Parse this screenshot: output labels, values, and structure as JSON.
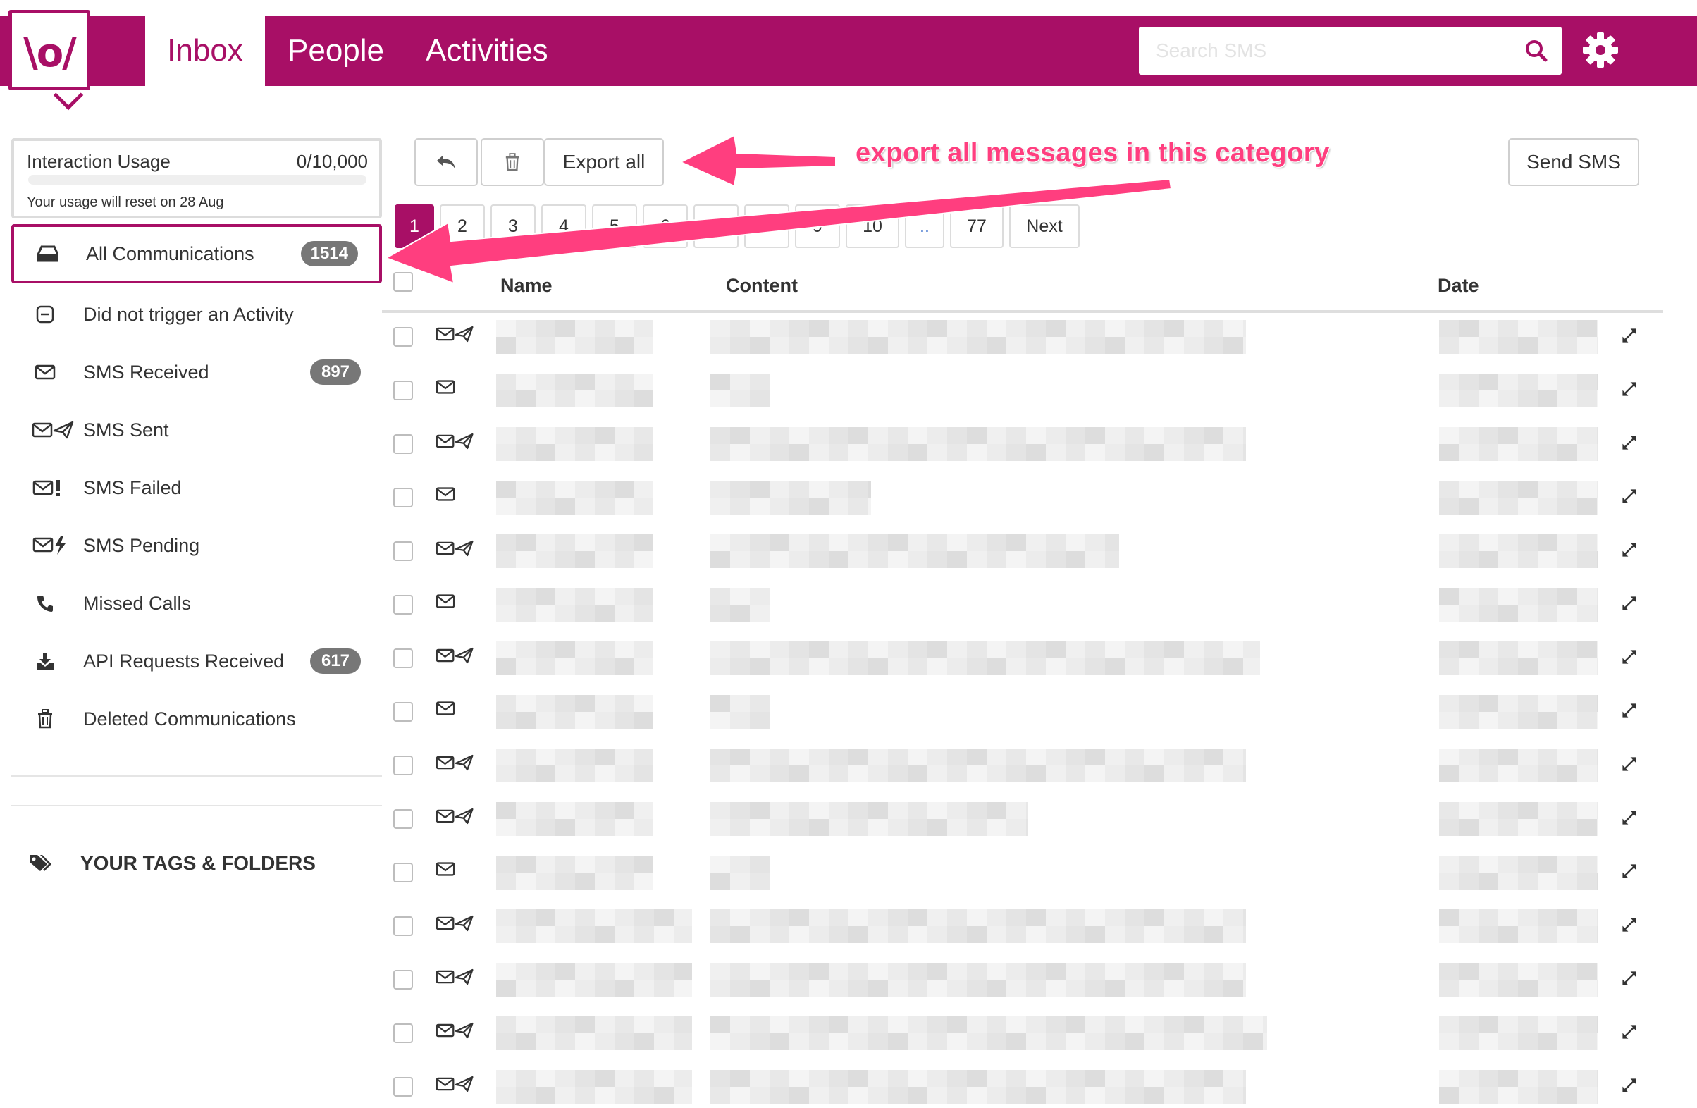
{
  "app": {
    "logo_text": "\\o/",
    "nav": {
      "inbox": "Inbox",
      "people": "People",
      "activities": "Activities"
    },
    "search": {
      "placeholder": "Search SMS",
      "value": ""
    },
    "icons": {
      "search": "search-icon",
      "settings": "gear-icon"
    },
    "colors": {
      "brand": "#a80f66",
      "badge": "#777777",
      "annotation": "#ff3e7f"
    }
  },
  "sidebar": {
    "usage": {
      "title": "Interaction Usage",
      "count": "0/10,000",
      "progress_fraction": 0,
      "note": "Your usage will reset on 28 Aug"
    },
    "items": [
      {
        "label": "All Communications",
        "badge": "1514",
        "icon": "inbox-tray-icon",
        "active": true
      },
      {
        "label": "Did not trigger an Activity",
        "badge": "",
        "icon": "minus-square-icon",
        "active": false
      },
      {
        "label": "SMS Received",
        "badge": "897",
        "icon": "envelope-icon",
        "active": false
      },
      {
        "label": "SMS Sent",
        "badge": "",
        "icon": "envelope-sent-icon",
        "active": false
      },
      {
        "label": "SMS Failed",
        "badge": "",
        "icon": "envelope-failed-icon",
        "active": false
      },
      {
        "label": "SMS Pending",
        "badge": "",
        "icon": "envelope-pending-icon",
        "active": false
      },
      {
        "label": "Missed Calls",
        "badge": "",
        "icon": "phone-icon",
        "active": false
      },
      {
        "label": "API Requests Received",
        "badge": "617",
        "icon": "download-icon",
        "active": false
      },
      {
        "label": "Deleted Communications",
        "badge": "",
        "icon": "trash-icon",
        "active": false
      }
    ],
    "tags_heading": "YOUR TAGS & FOLDERS"
  },
  "toolbar": {
    "export_label": "Export all",
    "send_label": "Send SMS",
    "reply_icon": "reply-icon",
    "delete_icon": "trash-icon"
  },
  "pagination": {
    "pages": [
      "1",
      "2",
      "3",
      "4",
      "5",
      "6",
      "7",
      "8",
      "9",
      "10",
      "..",
      "77",
      "Next"
    ],
    "current": "1"
  },
  "table": {
    "columns": {
      "name": "Name",
      "content": "Content",
      "date": "Date"
    },
    "rows": [
      {
        "type": "sent"
      },
      {
        "type": "received"
      },
      {
        "type": "sent"
      },
      {
        "type": "received"
      },
      {
        "type": "sent"
      },
      {
        "type": "received"
      },
      {
        "type": "sent"
      },
      {
        "type": "received"
      },
      {
        "type": "sent"
      },
      {
        "type": "sent"
      },
      {
        "type": "received"
      },
      {
        "type": "sent"
      },
      {
        "type": "sent"
      },
      {
        "type": "sent"
      },
      {
        "type": "sent"
      }
    ]
  },
  "annotation": {
    "text": "export all messages in this category"
  }
}
